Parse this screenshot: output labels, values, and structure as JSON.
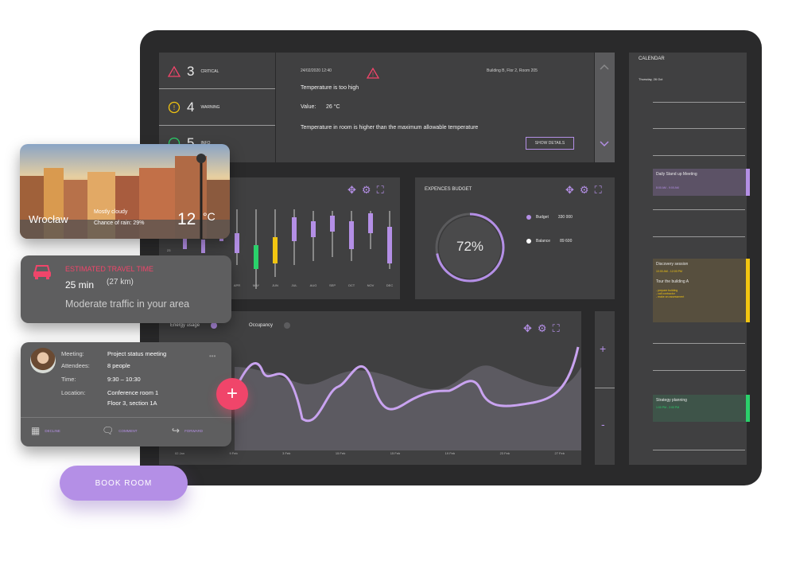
{
  "alerts": {
    "critical": {
      "count": "3",
      "label": "CRITICAL"
    },
    "warning": {
      "count": "4",
      "label": "WARNING"
    },
    "info": {
      "count": "5",
      "label": "INFO"
    }
  },
  "alert_detail": {
    "datetime": "24/02/2020 12:40",
    "location": "Building B, Flor 2, Room 205",
    "title": "Temperature is too high",
    "value_label": "Value:",
    "value": "26 °C",
    "description": "Temperature in room is higher than the maximum allowable temperature",
    "button": "SHOW DETAILS"
  },
  "candlestick": {
    "months": [
      "APR",
      "MAY",
      "JUN",
      "JUL",
      "AUG",
      "SEP",
      "OCT",
      "NOV",
      "DEC"
    ],
    "y_tick": "23"
  },
  "budget": {
    "title": "EXPENCES BUDGET",
    "percent": "72%",
    "percent_value": 72,
    "legend": [
      {
        "label": "Budget",
        "value": "330 000",
        "color": "#b48fe6"
      },
      {
        "label": "Balance",
        "value": "89 600",
        "color": "#ffffff"
      }
    ]
  },
  "energy": {
    "legend_energy": "Energy usage",
    "legend_occupancy": "Occupancy",
    "x_ticks": [
      "02 Jan",
      "9 Feb",
      "3 Feb",
      "15 Feb",
      "15 Feb",
      "19 Feb",
      "23 Feb",
      "27 Feb"
    ],
    "zoom_in": "+",
    "zoom_out": "-"
  },
  "calendar": {
    "title": "CALENDAR",
    "date": "Thursday, 26 Oct",
    "events": [
      {
        "title": "Daily Stand up Meeting",
        "time": "8:00 AM - 9:00 AM"
      },
      {
        "title": "Discovery session",
        "time": "10:00 AM - 12:00 PM",
        "sub": "Tour the building A",
        "notes": [
          "- prepare building",
          "- call contractor",
          "- make an assessment"
        ]
      },
      {
        "title": "Strategy planning",
        "time": "1:00 PM - 2:00 PM"
      }
    ]
  },
  "weather": {
    "city": "Wrocław",
    "condition": "Mostly cloudy",
    "rain": "Chance of rain: 29%",
    "temp": "12",
    "unit": "°C"
  },
  "travel": {
    "title": "ESTIMATED TRAVEL TIME",
    "time": "25 min",
    "distance": "(27 km)",
    "traffic": "Moderate traffic in your area"
  },
  "meeting": {
    "meeting_label": "Meeting:",
    "meeting_value": "Project status meeting",
    "attendees_label": "Attendees:",
    "attendees_value": "8 people",
    "time_label": "Time:",
    "time_value": "9:30 – 10:30",
    "location_label": "Location:",
    "location_line1": "Conference room 1",
    "location_line2": "Floor 3, section 1A",
    "more": "•••",
    "decline": "DECLINE",
    "comment": "COMMENT",
    "forward": "FORWARD",
    "add": "+"
  },
  "book_room": "BOOK ROOM"
}
